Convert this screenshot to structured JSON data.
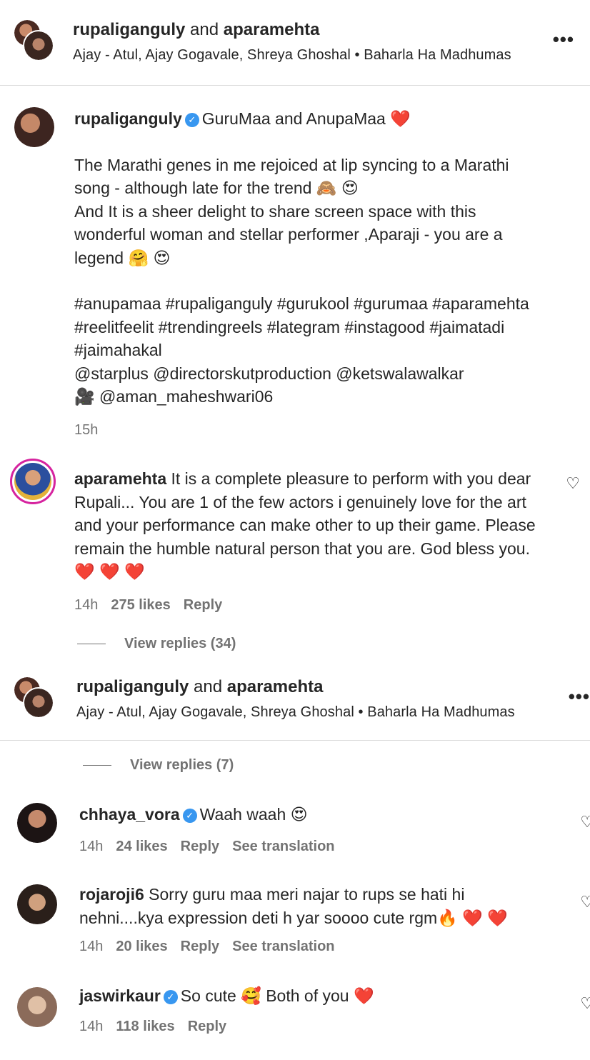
{
  "header": {
    "user1": "rupaliganguly",
    "and_label": "and",
    "user2": "aparamehta",
    "audio": "Ajay - Atul, Ajay Gogavale, Shreya Ghoshal • Baharla Ha Madhumas",
    "more_label": "•••"
  },
  "caption": {
    "username": "rupaliganguly",
    "first_line": "GuruMaa and AnupaMaa ❤️",
    "para1_a": "The Marathi genes in me rejoiced at lip syncing to a Marathi",
    "para1_b": "song - although late for the trend 🙈 😍",
    "para2_a": "And It is a sheer delight to share screen space with this",
    "para2_b": "wonderful woman and stellar performer ,Aparaji - you are a",
    "para2_c": "legend 🤗 😍",
    "tags_a": "#anupamaa #rupaliganguly #gurukool #gurumaa #aparamehta",
    "tags_b": "#reelitfeelit #trendingreels #lategram #instagood #jaimatadi",
    "tags_c": "#jaimahakal",
    "mentions_a": "@starplus @directorskutproduction @ketswalawalkar",
    "mentions_b": "🎥 @aman_maheshwari06",
    "time": "15h"
  },
  "comments": [
    {
      "username": "aparamehta",
      "line1": "It is a complete pleasure to perform with you dear",
      "line2": "Rupali... You are 1 of the few actors i genuinely love for the art",
      "line3": "and your performance can make other to up their game. Please",
      "line4": "remain the humble natural person that you are. God bless you.",
      "line5": "❤️ ❤️ ❤️",
      "time": "14h",
      "likes": "275 likes",
      "reply": "Reply",
      "view_replies": "View replies (34)"
    },
    {
      "view_replies": "View replies (7)"
    },
    {
      "username": "chhaya_vora",
      "text": "Waah waah 😍",
      "time": "14h",
      "likes": "24 likes",
      "reply": "Reply",
      "translate": "See translation"
    },
    {
      "username": "rojaroji6",
      "line1": "Sorry guru maa meri najar to rups se hati hi",
      "line2": "nehni....kya expression deti h yar soooo cute rgm🔥 ❤️ ❤️",
      "time": "14h",
      "likes": "20 likes",
      "reply": "Reply",
      "translate": "See translation"
    },
    {
      "username": "jaswirkaur",
      "text": "So cute 🥰 Both of you ❤️",
      "time": "14h",
      "likes": "118 likes",
      "reply": "Reply"
    }
  ],
  "icons": {
    "verified": "verified-badge-icon",
    "heart": "heart-outline-icon",
    "more": "more-horizontal-icon"
  },
  "colors": {
    "text": "#262626",
    "muted": "#737373",
    "verified": "#3897f0",
    "divider": "#dbdbdb"
  }
}
